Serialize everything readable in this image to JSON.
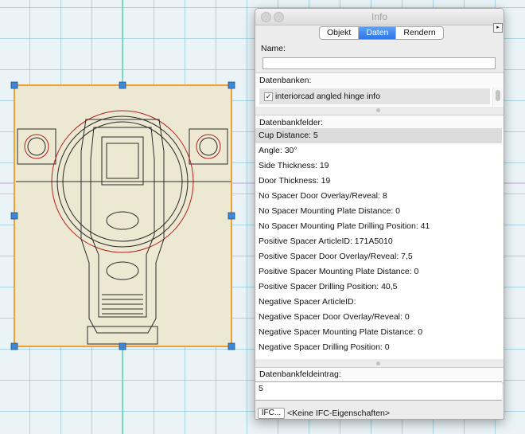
{
  "window": {
    "title": "Info"
  },
  "tabs": [
    {
      "label": "Objekt",
      "active": false
    },
    {
      "label": "Daten",
      "active": true
    },
    {
      "label": "Rendern",
      "active": false
    }
  ],
  "name_section": {
    "label": "Name:",
    "value": ""
  },
  "databases": {
    "header": "Datenbanken:",
    "items": [
      {
        "label": "interiorcad angled hinge info",
        "checked": true,
        "check_glyph": "✓"
      }
    ]
  },
  "fields": {
    "header": "Datenbankfelder:",
    "items": [
      "Cup Distance: 5",
      "Angle: 30°",
      "Side Thickness: 19",
      "Door Thickness: 19",
      "No Spacer Door Overlay/Reveal: 8",
      "No Spacer Mounting Plate Distance: 0",
      "No Spacer Mounting Plate Drilling Position: 41",
      "Positive Spacer ArticleID: 171A5010",
      "Positive Spacer Door Overlay/Reveal: 7,5",
      "Positive Spacer Mounting Plate Distance: 0",
      "Positive Spacer Drilling Position: 40,5",
      "Negative Spacer ArticleID:",
      "Negative Spacer Door Overlay/Reveal: 0",
      "Negative Spacer Mounting Plate Distance: 0",
      "Negative Spacer Drilling Position: 0"
    ],
    "selected_index": 0
  },
  "entry": {
    "label": "Datenbankfeldeintrag:",
    "value": "5"
  },
  "ifc": {
    "button_label": "IFC...",
    "status": "<Keine IFC-Eigenschaften>"
  },
  "palette_menu_glyph": "▸",
  "colors": {
    "selection": "#f0a030",
    "handle": "#3d88d6",
    "grid": "#78b9cd",
    "guide_vertical": "#5fd6b0",
    "guide_horizontal": "#c8a0d8",
    "object_fill": "#ede8d2",
    "circle_red": "#b02020",
    "tab_active": "#3a7fee"
  }
}
